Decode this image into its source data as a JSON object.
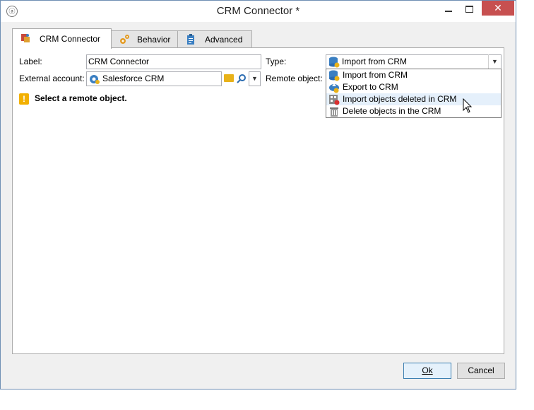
{
  "window": {
    "title": "CRM Connector *",
    "app_icon": "adobe-campaign-icon"
  },
  "tabs": [
    {
      "label": "CRM Connector",
      "icon": "crm-connector-icon",
      "active": true
    },
    {
      "label": "Behavior",
      "icon": "gears-icon",
      "active": false
    },
    {
      "label": "Advanced",
      "icon": "clipboard-icon",
      "active": false
    }
  ],
  "form": {
    "label_caption": "Label:",
    "label_value": "CRM Connector",
    "type_caption": "Type:",
    "type_value": "Import from CRM",
    "external_account_caption": "External account:",
    "external_account_value": "Salesforce CRM",
    "remote_object_caption": "Remote object:"
  },
  "warning": {
    "text": "Select a remote object.",
    "icon": "warning-icon"
  },
  "type_dropdown": {
    "options": [
      {
        "label": "Import from CRM",
        "icon": "database-import-icon"
      },
      {
        "label": "Export to CRM",
        "icon": "cloud-upload-icon"
      },
      {
        "label": "Import objects deleted in CRM",
        "icon": "delete-grid-icon"
      },
      {
        "label": "Delete objects in the CRM",
        "icon": "trash-icon"
      }
    ],
    "hovered_index": 2
  },
  "buttons": {
    "ok": "Ok",
    "cancel": "Cancel"
  },
  "colors": {
    "close_button": "#c75050",
    "warning": "#f2b000",
    "hover": "#e5f0fb"
  }
}
